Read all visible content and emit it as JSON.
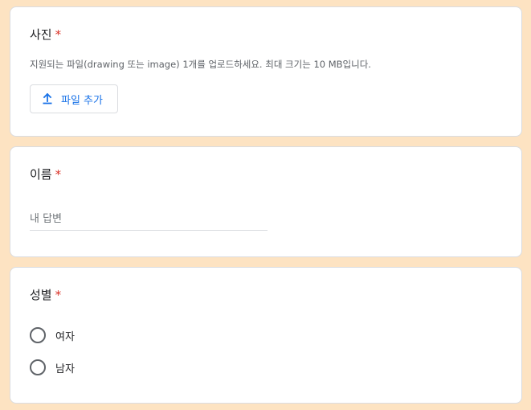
{
  "photo": {
    "title": "사진",
    "required": "*",
    "hint": "지원되는 파일(drawing 또는 image) 1개를 업로드하세요. 최대 크기는 10 MB입니다.",
    "upload_label": "파일 추가",
    "upload_icon": "upload-icon"
  },
  "name": {
    "title": "이름",
    "required": "*",
    "placeholder": "내 답변",
    "value": ""
  },
  "gender": {
    "title": "성별",
    "required": "*",
    "options": [
      {
        "label": "여자",
        "selected": false
      },
      {
        "label": "남자",
        "selected": false
      }
    ]
  },
  "colors": {
    "background": "#fde3c2",
    "required": "#d93025",
    "accent": "#1a73e8"
  }
}
